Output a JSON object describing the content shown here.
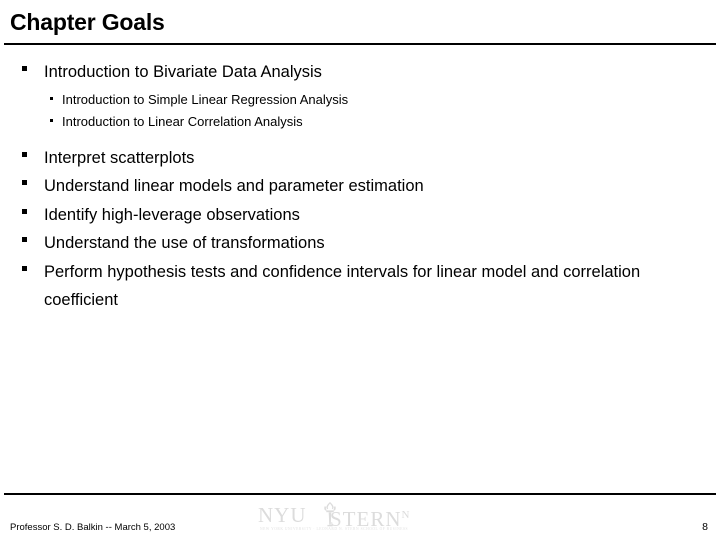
{
  "slide": {
    "title": "Chapter Goals",
    "page_number": "8",
    "footer_text": "Professor S. D. Balkin -- March 5, 2003",
    "text_color": "#000000",
    "background_color": "#ffffff",
    "rule_color": "#000000"
  },
  "bullets": [
    {
      "marker": "square-bullet",
      "text": "Introduction to Bivariate Data Analysis",
      "sub": [
        {
          "marker": "dot-bullet",
          "text": "Introduction to Simple Linear Regression Analysis"
        },
        {
          "marker": "dot-bullet",
          "text": "Introduction to Linear Correlation Analysis"
        }
      ]
    },
    {
      "marker": "square-bullet",
      "text": "Interpret scatterplots",
      "sub": []
    },
    {
      "marker": "square-bullet",
      "text": "Understand linear models and parameter estimation",
      "sub": []
    },
    {
      "marker": "square-bullet",
      "text": "Identify high-leverage observations",
      "sub": []
    },
    {
      "marker": "square-bullet",
      "text": "Understand the use of transformations",
      "sub": []
    },
    {
      "marker": "square-bullet",
      "text": "Perform hypothesis tests and confidence intervals for linear model and correlation coefficient",
      "sub": []
    }
  ],
  "logo": {
    "name": "nyu-stern-logo",
    "word_one": "NYU",
    "word_two": "STERN",
    "superscript": "N",
    "tagline": "NEW YORK UNIVERSITY · LEONARD N. STERN SCHOOL OF BUSINESS",
    "color": "#dcdcdc",
    "icon": "torch-icon"
  }
}
